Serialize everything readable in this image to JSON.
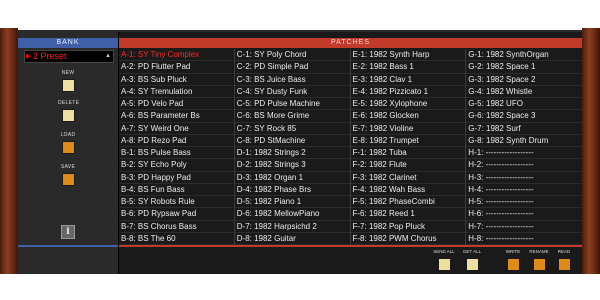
{
  "bank": {
    "header": "BANK",
    "preset_value": "2 Preset",
    "buttons": [
      {
        "label": "NEW",
        "color": "#eedfa0"
      },
      {
        "label": "DELETE",
        "color": "#eedfa0"
      },
      {
        "label": "LOAD",
        "color": "#e08a18"
      },
      {
        "label": "SAVE",
        "color": "#e08a18"
      }
    ],
    "info_icon": "i"
  },
  "patches": {
    "header": "PATCHES",
    "selected": "A-1: SY Tiny Complex",
    "columns": [
      [
        "A-1: SY Tiny Complex",
        "A-2: PD Flutter Pad",
        "A-3: BS Sub Pluck",
        "A-4: SY Tremulation",
        "A-5: PD Velo Pad",
        "A-6: BS Parameter Bs",
        "A-7: SY Weird One",
        "A-8: PD Rezo Pad",
        "B-1: BS Pulse Bass",
        "B-2: SY Echo Poly",
        "B-3: PD Happy Pad",
        "B-4: BS Fun Bass",
        "B-5: SY Robots Rule",
        "B-6: PD Rypsaw Pad",
        "B-7: BS Chorus Bass",
        "B-8: BS The 60"
      ],
      [
        "C-1: SY Poly Chord",
        "C-2: PD Simple Pad",
        "C-3: BS Juice Bass",
        "C-4: SY Dusty Funk",
        "C-5: PD Pulse Machine",
        "C-6: BS More Grime",
        "C-7: SY Rock 85",
        "C-8: PD StMachine",
        "D-1: 1982 Strings 2",
        "D-2: 1982 Strings 3",
        "D-3: 1982 Organ 1",
        "D-4: 1982 Phase Brs",
        "D-5: 1982 Piano 1",
        "D-6: 1982 MellowPiano",
        "D-7: 1982 Harpsichd 2",
        "D-8: 1982 Guitar"
      ],
      [
        "E-1: 1982 Synth Harp",
        "E-2: 1982 Bass 1",
        "E-3: 1982 Clav 1",
        "E-4: 1982 Pizzicato 1",
        "E-5: 1982 Xylophone",
        "E-6: 1982 Glocken",
        "E-7: 1982 Violine",
        "E-8: 1982 Trumpet",
        "F-1: 1982 Tuba",
        "F-2: 1982 Flute",
        "F-3: 1982 Clarinet",
        "F-4: 1982 Wah Bass",
        "F-5: 1982 PhaseCombi",
        "F-6: 1982 Reed 1",
        "F-7: 1982 Pop Pluck",
        "F-8: 1982 PWM Chorus"
      ],
      [
        "G-1: 1982 SynthOrgan",
        "G-2: 1982 Space 1",
        "G-3: 1982 Space 2",
        "G-4: 1982 Whistle",
        "G-5: 1982 UFO",
        "G-6: 1982 Space 3",
        "G-7: 1982 Surf",
        "G-8: 1982 Synth Drum",
        "H-1: ------------------",
        "H-2: ------------------",
        "H-3: ------------------",
        "H-4: ------------------",
        "H-5: ------------------",
        "H-6: ------------------",
        "H-7: ------------------",
        "H-8: ------------------"
      ]
    ]
  },
  "bottom_buttons": [
    {
      "label": "SEND ALL",
      "color": "#eedfa0"
    },
    {
      "label": "GET ALL",
      "color": "#eedfa0"
    },
    {
      "label": "WRITE",
      "color": "#e08a18"
    },
    {
      "label": "RENAME",
      "color": "#e08a18"
    },
    {
      "label": "READ",
      "color": "#e08a18"
    }
  ],
  "colors": {
    "bank_accent": "#3f5fa6",
    "patches_accent": "#c23a2a",
    "selected_text": "#ff2a2a"
  }
}
